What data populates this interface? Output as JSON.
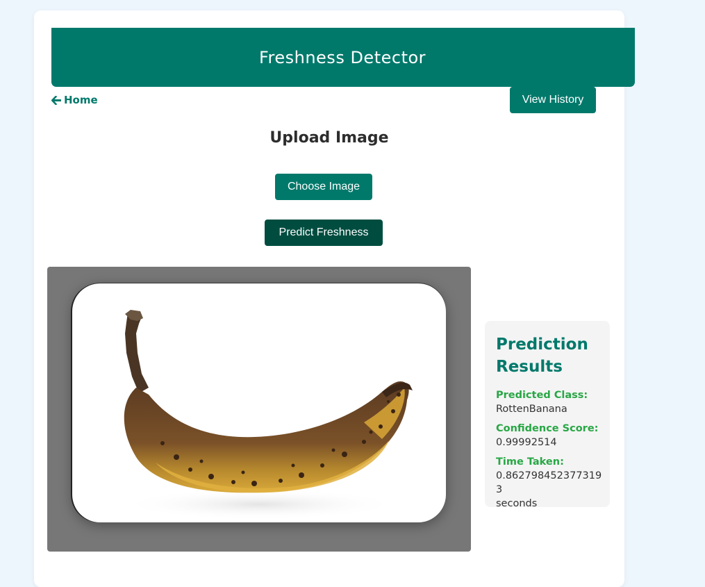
{
  "header": {
    "title": "Freshness Detector"
  },
  "nav": {
    "home_label": "Home",
    "history_label": "View History"
  },
  "upload": {
    "title": "Upload Image",
    "choose_label": "Choose Image",
    "predict_label": "Predict Freshness"
  },
  "results": {
    "title": "Prediction Results",
    "predicted_class_label": "Predicted Class:",
    "predicted_class_value": "RottenBanana",
    "confidence_label": "Confidence Score:",
    "confidence_value": "0.99992514",
    "time_label": "Time Taken:",
    "time_value": "0.8627984523773193",
    "time_unit": "seconds"
  },
  "colors": {
    "brand": "#00796b",
    "brand_dark": "#004d40",
    "result_label": "#28a745",
    "background": "#eef6fd"
  },
  "icons": {
    "home": "arrow-left-icon"
  }
}
